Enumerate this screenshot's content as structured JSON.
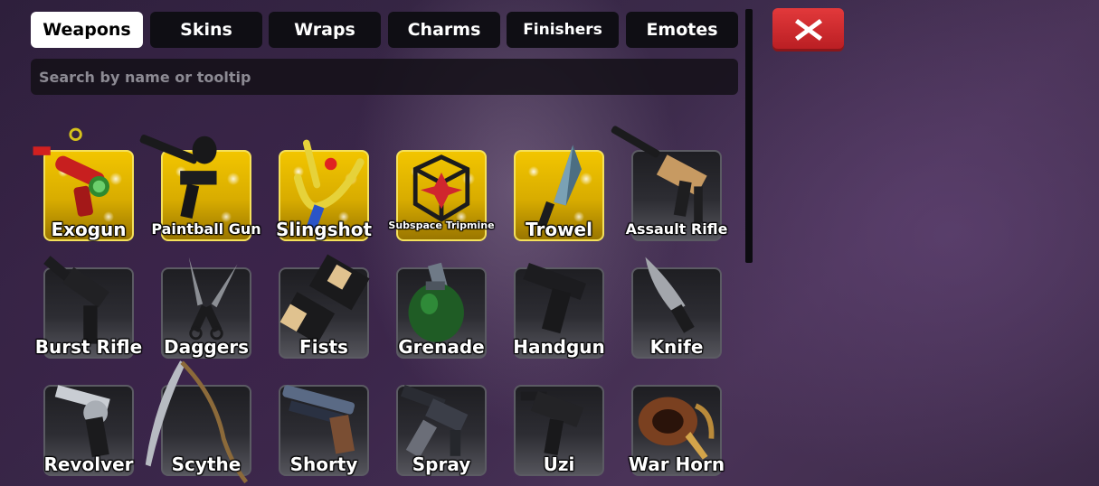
{
  "tabs": [
    {
      "label": "Weapons",
      "active": true
    },
    {
      "label": "Skins"
    },
    {
      "label": "Wraps"
    },
    {
      "label": "Charms"
    },
    {
      "label": "Finishers"
    },
    {
      "label": "Emotes"
    }
  ],
  "close_button": {
    "icon": "close-x-icon",
    "color": "#d62b2f"
  },
  "search": {
    "placeholder": "Search by name or tooltip",
    "value": ""
  },
  "colors": {
    "gold_tile": "#e3b800",
    "gold_border": "#f4e05b",
    "tile": "#2a2a30"
  },
  "items": [
    {
      "label": "Exogun",
      "rarity": "gold",
      "icon": "exogun-icon"
    },
    {
      "label": "Paintball Gun",
      "rarity": "gold",
      "icon": "paintball-gun-icon"
    },
    {
      "label": "Slingshot",
      "rarity": "gold",
      "icon": "slingshot-icon"
    },
    {
      "label": "Subspace Tripmine",
      "rarity": "gold",
      "icon": "tripmine-icon"
    },
    {
      "label": "Trowel",
      "rarity": "gold",
      "icon": "trowel-icon"
    },
    {
      "label": "Assault Rifle",
      "rarity": "default",
      "icon": "assault-rifle-icon"
    },
    {
      "label": "Burst Rifle",
      "rarity": "default",
      "icon": "burst-rifle-icon"
    },
    {
      "label": "Daggers",
      "rarity": "default",
      "icon": "daggers-icon"
    },
    {
      "label": "Fists",
      "rarity": "default",
      "icon": "fists-icon"
    },
    {
      "label": "Grenade",
      "rarity": "default",
      "icon": "grenade-icon"
    },
    {
      "label": "Handgun",
      "rarity": "default",
      "icon": "handgun-icon"
    },
    {
      "label": "Knife",
      "rarity": "default",
      "icon": "knife-icon"
    },
    {
      "label": "Revolver",
      "rarity": "default",
      "icon": "revolver-icon"
    },
    {
      "label": "Scythe",
      "rarity": "default",
      "icon": "scythe-icon"
    },
    {
      "label": "Shorty",
      "rarity": "default",
      "icon": "shorty-icon"
    },
    {
      "label": "Spray",
      "rarity": "default",
      "icon": "spray-icon"
    },
    {
      "label": "Uzi",
      "rarity": "default",
      "icon": "uzi-icon"
    },
    {
      "label": "War Horn",
      "rarity": "default",
      "icon": "war-horn-icon"
    }
  ]
}
